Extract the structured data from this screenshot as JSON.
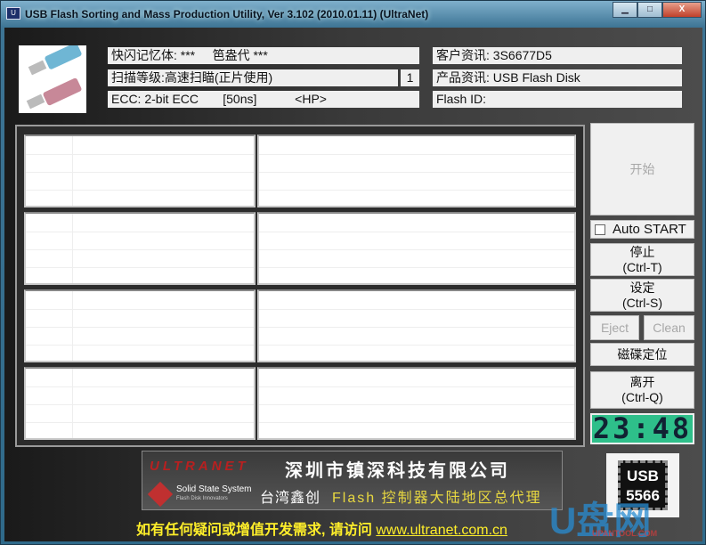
{
  "window": {
    "title": "USB Flash Sorting and Mass Production Utility, Ver 3.102  (2010.01.11) (UltraNet)",
    "icon": "app-icon",
    "controls": [
      "minimize",
      "maximize",
      "close"
    ]
  },
  "info": {
    "flash_memory": "快闪记忆体: ***     笆盎代 ***",
    "scan_level": "扫描等级:高速扫瞄(正片使用)",
    "scan_count": "1",
    "ecc": "ECC: 2-bit ECC       [50ns]           <HP>",
    "customer": "客户资讯: 3S6677D5",
    "product": "产品资讯: USB Flash Disk",
    "flash_id": "Flash ID:"
  },
  "ports": [
    {},
    {},
    {},
    {}
  ],
  "buttons": {
    "start": "开始",
    "auto_start": "Auto START",
    "auto_start_checked": false,
    "stop": "停止",
    "stop_key": "(Ctrl-T)",
    "settings": "设定",
    "settings_key": "(Ctrl-S)",
    "eject": "Eject",
    "clean": "Clean",
    "disk_locate": "磁碟定位",
    "exit": "离开",
    "exit_key": "(Ctrl-Q)"
  },
  "clock": "23:48",
  "banner": {
    "logo": "ULTRANET",
    "company": "深圳市镇深科技有限公司",
    "partner_logo": "Solid State System",
    "partner_sub": "Flash Disk Innovators",
    "agent_prefix": "台湾鑫创",
    "agent_suffix": "Flash 控制器大陆地区总代理"
  },
  "chip": {
    "line1": "USB",
    "line2": "5566"
  },
  "footer": {
    "text": "如有任何疑问或增值开发需求, 请访问 ",
    "link": "www.ultranet.com.cn"
  },
  "watermark": {
    "text": "U盘网",
    "sub": "UPANTOOL.COM"
  },
  "colors": {
    "clock_bg": "#2ebf8a",
    "footer_text": "#ffef2a"
  }
}
